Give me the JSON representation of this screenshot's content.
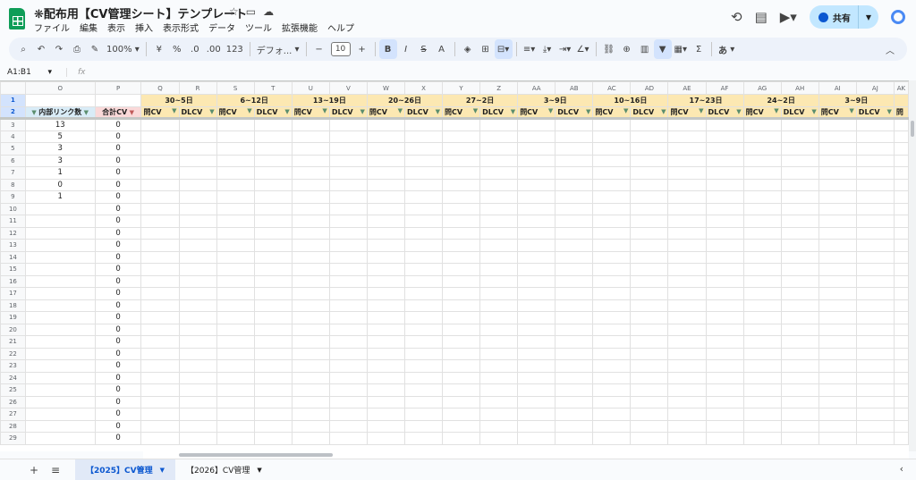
{
  "doc": {
    "title": "❋配布用【CV管理シート】テンプレート",
    "menu": [
      "ファイル",
      "編集",
      "表示",
      "挿入",
      "表示形式",
      "データ",
      "ツール",
      "拡張機能",
      "ヘルプ"
    ],
    "share_label": "共有"
  },
  "toolbar": {
    "zoom": "100%",
    "currency": "¥",
    "percent": "%",
    "dec_decrease": ".0",
    "dec_increase": ".00",
    "number_format": "123",
    "font": "デフォ...",
    "font_size": "10",
    "bold": "B",
    "italic": "I",
    "strike": "S",
    "text_color": "A",
    "input_tools": "あ"
  },
  "formula_bar": {
    "name_box": "A1:B1",
    "fx": "fx"
  },
  "grid": {
    "columns": [
      "O",
      "P",
      "Q",
      "R",
      "S",
      "T",
      "U",
      "V",
      "W",
      "X",
      "Y",
      "Z",
      "AA",
      "AB",
      "AC",
      "AD",
      "AE",
      "AF",
      "AG",
      "AH",
      "AI",
      "AJ",
      "AK"
    ],
    "weeks": [
      "30~5日",
      "6~12日",
      "13~19日",
      "20~26日",
      "27~2日",
      "3~9日",
      "10~16日",
      "17~23日",
      "24~2日",
      "3~9日"
    ],
    "header_o": "内部リンク数",
    "header_p": "合計CV",
    "sub_a": "問CV",
    "sub_b": "DLCV",
    "sub_last": "問",
    "rows": [
      {
        "n": "3",
        "o": "13",
        "p": "0"
      },
      {
        "n": "4",
        "o": "5",
        "p": "0"
      },
      {
        "n": "5",
        "o": "3",
        "p": "0"
      },
      {
        "n": "6",
        "o": "3",
        "p": "0"
      },
      {
        "n": "7",
        "o": "1",
        "p": "0"
      },
      {
        "n": "8",
        "o": "0",
        "p": "0"
      },
      {
        "n": "9",
        "o": "1",
        "p": "0"
      },
      {
        "n": "10",
        "o": "",
        "p": "0"
      },
      {
        "n": "11",
        "o": "",
        "p": "0"
      },
      {
        "n": "12",
        "o": "",
        "p": "0"
      },
      {
        "n": "13",
        "o": "",
        "p": "0"
      },
      {
        "n": "14",
        "o": "",
        "p": "0"
      },
      {
        "n": "15",
        "o": "",
        "p": "0"
      },
      {
        "n": "16",
        "o": "",
        "p": "0"
      },
      {
        "n": "17",
        "o": "",
        "p": "0"
      },
      {
        "n": "18",
        "o": "",
        "p": "0"
      },
      {
        "n": "19",
        "o": "",
        "p": "0"
      },
      {
        "n": "20",
        "o": "",
        "p": "0"
      },
      {
        "n": "21",
        "o": "",
        "p": "0"
      },
      {
        "n": "22",
        "o": "",
        "p": "0"
      },
      {
        "n": "23",
        "o": "",
        "p": "0"
      },
      {
        "n": "24",
        "o": "",
        "p": "0"
      },
      {
        "n": "25",
        "o": "",
        "p": "0"
      },
      {
        "n": "26",
        "o": "",
        "p": "0"
      },
      {
        "n": "27",
        "o": "",
        "p": "0"
      },
      {
        "n": "28",
        "o": "",
        "p": "0"
      },
      {
        "n": "29",
        "o": "",
        "p": "0"
      }
    ]
  },
  "sheets": {
    "tabs": [
      "【2025】CV管理",
      "【2026】CV管理"
    ],
    "active": 0
  },
  "colors": {
    "week_header": "#fce8b2",
    "link_header": "#d9ecf7",
    "cv_header": "#fad9d9",
    "share_button": "#c2e7ff"
  }
}
